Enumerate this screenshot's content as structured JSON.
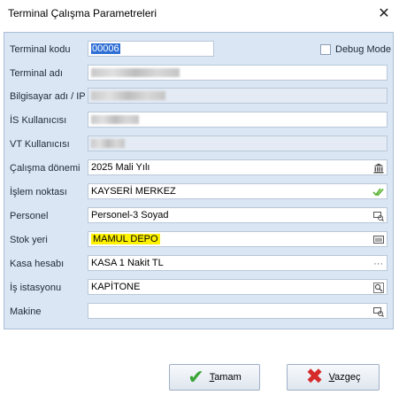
{
  "window": {
    "title": "Terminal Çalışma Parametreleri",
    "close_symbol": "✕"
  },
  "form": {
    "debug_mode_label": "Debug Mode",
    "fields": [
      {
        "label": "Terminal kodu",
        "value": "00006",
        "icon": ""
      },
      {
        "label": "Terminal adı",
        "value": "",
        "icon": ""
      },
      {
        "label": "Bilgisayar adı / IP",
        "value": "",
        "icon": ""
      },
      {
        "label": "İS Kullanıcısı",
        "value": "",
        "icon": ""
      },
      {
        "label": "VT Kullanıcısı",
        "value": "",
        "icon": ""
      },
      {
        "label": "Çalışma dönemi",
        "value": "2025 Mali Yılı",
        "icon": "bank-icon"
      },
      {
        "label": "İşlem noktası",
        "value": "KAYSERİ MERKEZ",
        "icon": "double-check-icon"
      },
      {
        "label": "Personel",
        "value": "Personel-3 Soyad",
        "icon": "lookup-icon"
      },
      {
        "label": "Stok yeri",
        "value": "MAMUL DEPO",
        "icon": "warehouse-icon"
      },
      {
        "label": "Kasa hesabı",
        "value": "KASA 1 Nakit TL",
        "icon": "ellipsis-icon"
      },
      {
        "label": "İş istasyonu",
        "value": "KAPİTONE",
        "icon": "search-icon"
      },
      {
        "label": "Makine",
        "value": "",
        "icon": "lookup-icon"
      }
    ]
  },
  "buttons": {
    "ok_prefix": "",
    "ok_underlined": "T",
    "ok_rest": "amam",
    "cancel_underlined": "V",
    "cancel_rest": "azgeç"
  }
}
